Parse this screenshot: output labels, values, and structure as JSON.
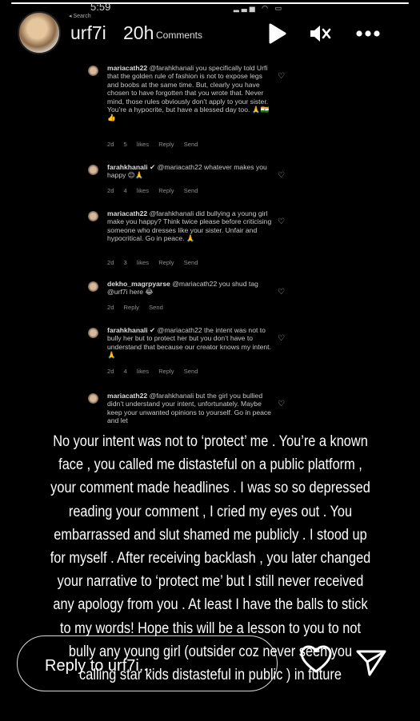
{
  "story": {
    "progress": 1.0,
    "username": "urf7i",
    "age": "20h",
    "text": "No your intent was not to ‘protect’ me . You’re a known face , you called me distasteful on a public platform , your comment made headlines . I was so so depressed reading your comment , I cried my eyes out . You embarrassed and slut shamed me  publicly . I stood up for myself . After receiving backlash , you later changed your narrative to ‘protect me’ but I still never received any apology from you .  At least I have the balls to stick to my words! Hope this will be a lesson to you to not bully any young girl (outsider coz never seen you calling star kids distasteful in public ) in future"
  },
  "inner_screenshot": {
    "time": "5:59",
    "back_label": "◂ Search",
    "status_icons": "▂▃▅ ◠ ▭",
    "title": "Comments",
    "comments": [
      {
        "user": "mariacath22",
        "text": "@farahkhanali you specifically told Urfi that the golden rule of fashion is not to expose legs and boobs at the same time. But, clearly you have chosen to have forgotten that you wrote that. Never mind, those rules obviously don’t apply to your sister. You’re a hypocrite, but have a blessed day too. 🙏🇮🇳👍",
        "meta": "2d  5 likes  Reply  Send"
      },
      {
        "user": "farahkhanali ✔",
        "text": "@mariacath22 whatever makes you happy 😊🙏",
        "meta": "2d  4 likes  Reply  Send"
      },
      {
        "user": "mariacath22",
        "text": "@farahkhanali did bullying a young girl make you happy? Think twice please before criticising someone who dresses like your sister. Unfair and hypocritical. Go in peace. 🙏",
        "meta": "2d  3 likes  Reply  Send"
      },
      {
        "user": "dekho_magrpyarse",
        "text": "@mariacath22 you shud tag @urf7i here 😂",
        "meta": "2d  Reply  Send"
      },
      {
        "user": "farahkhanali ✔",
        "text": "@mariacath22 the intent was not to bully her but to protect her but you don’t have to understand that because our creator knows my intent. 🙏",
        "meta": "2d  4 likes  Reply  Send"
      },
      {
        "user": "mariacath22",
        "text": "@farahkhanali but the girl you bullied didn’t understand your intent, unfortunately. Maybe keep your unwanted opinions to yourself. Go in peace and let",
        "meta": ""
      }
    ]
  },
  "reply": {
    "placeholder": "Reply to urf7i..."
  },
  "colors": {
    "background": "#000000",
    "text": "#ffffff",
    "muted": "#8d8d8d"
  }
}
